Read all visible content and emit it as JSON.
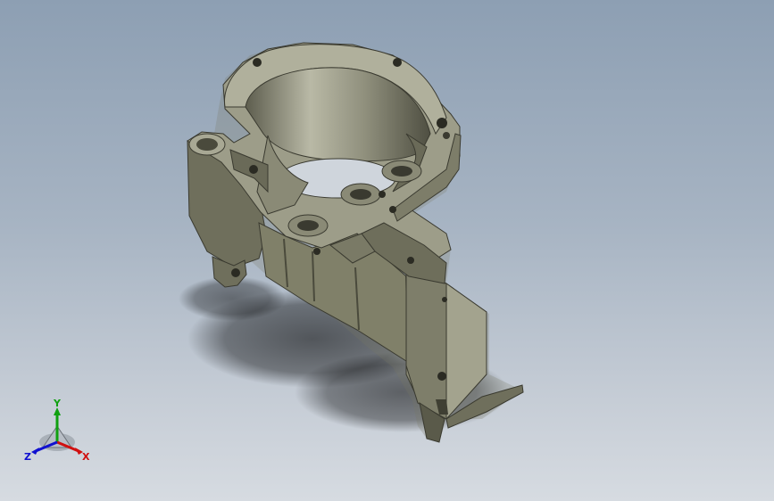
{
  "viewport": {
    "background_top": "#8d9fb3",
    "background_bottom": "#d6dbe1",
    "part_color": "#7b7b68"
  },
  "triad": {
    "icon": "reference-triad-icon",
    "x_label": "X",
    "y_label": "Y",
    "z_label": "Z",
    "x_color": "#d01010",
    "y_color": "#10a010",
    "z_color": "#1010d0"
  }
}
